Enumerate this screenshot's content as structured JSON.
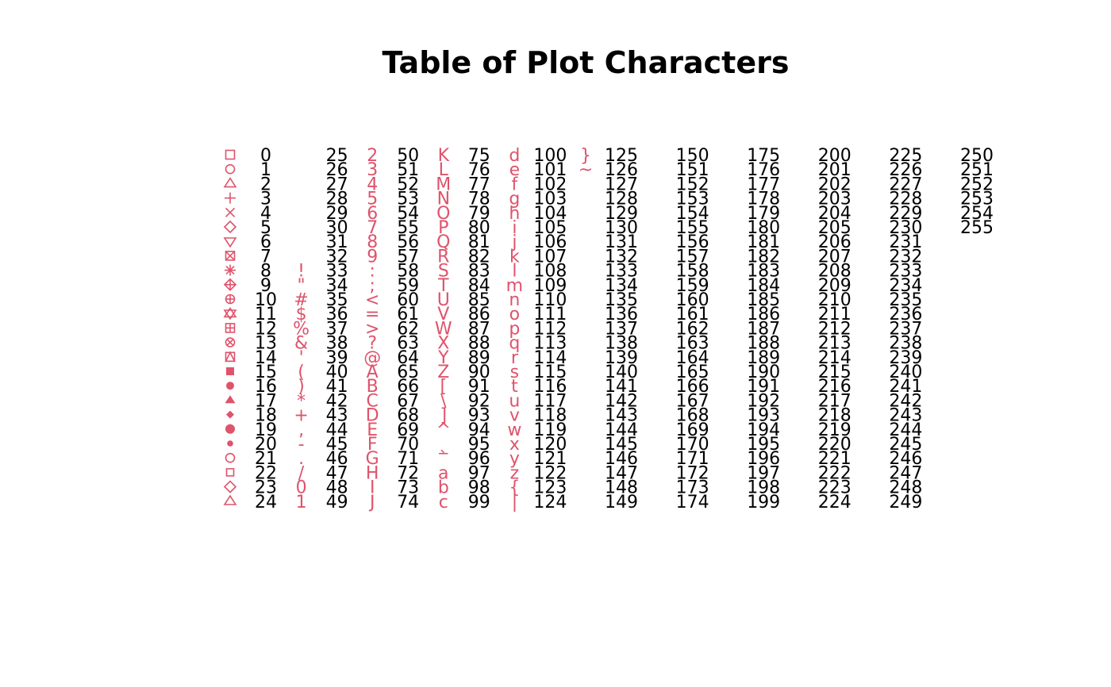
{
  "chart_data": {
    "type": "table",
    "title": "Table of Plot Characters",
    "symbol_color": "#DF536B",
    "number_color": "#000000",
    "codes": [
      0,
      1,
      2,
      3,
      4,
      5,
      6,
      7,
      8,
      9,
      10,
      11,
      12,
      13,
      14,
      15,
      16,
      17,
      18,
      19,
      20,
      21,
      22,
      23,
      24,
      25,
      26,
      27,
      28,
      29,
      30,
      31,
      32,
      33,
      34,
      35,
      36,
      37,
      38,
      39,
      40,
      41,
      42,
      43,
      44,
      45,
      46,
      47,
      48,
      49,
      50,
      51,
      52,
      53,
      54,
      55,
      56,
      57,
      58,
      59,
      60,
      61,
      62,
      63,
      64,
      65,
      66,
      67,
      68,
      69,
      70,
      71,
      72,
      73,
      74,
      75,
      76,
      77,
      78,
      79,
      80,
      81,
      82,
      83,
      84,
      85,
      86,
      87,
      88,
      89,
      90,
      91,
      92,
      93,
      94,
      95,
      96,
      97,
      98,
      99,
      100,
      101,
      102,
      103,
      104,
      105,
      106,
      107,
      108,
      109,
      110,
      111,
      112,
      113,
      114,
      115,
      116,
      117,
      118,
      119,
      120,
      121,
      122,
      123,
      124,
      125,
      126,
      127,
      128,
      129,
      130,
      131,
      132,
      133,
      134,
      135,
      136,
      137,
      138,
      139,
      140,
      141,
      142,
      143,
      144,
      145,
      146,
      147,
      148,
      149,
      150,
      151,
      152,
      153,
      154,
      155,
      156,
      157,
      158,
      159,
      160,
      161,
      162,
      163,
      164,
      165,
      166,
      167,
      168,
      169,
      170,
      171,
      172,
      173,
      174,
      175,
      176,
      177,
      178,
      179,
      180,
      181,
      182,
      183,
      184,
      185,
      186,
      187,
      188,
      189,
      190,
      191,
      192,
      193,
      194,
      195,
      196,
      197,
      198,
      199,
      200,
      201,
      202,
      203,
      204,
      205,
      206,
      207,
      208,
      209,
      210,
      211,
      212,
      213,
      214,
      215,
      216,
      217,
      218,
      219,
      220,
      221,
      222,
      223,
      224,
      225,
      226,
      227,
      228,
      229,
      230,
      231,
      232,
      233,
      234,
      235,
      236,
      237,
      238,
      239,
      240,
      241,
      242,
      243,
      244,
      245,
      246,
      247,
      248,
      249,
      250,
      251,
      252,
      253,
      254,
      255
    ],
    "pch_shapes": [
      "open-square",
      "open-circle",
      "open-triangle-up",
      "plus",
      "cross",
      "open-diamond",
      "open-triangle-down",
      "square-cross",
      "asterisk",
      "diamond-plus",
      "circle-plus",
      "star-of-david",
      "square-plus",
      "circle-cross",
      "square-triangle",
      "filled-square",
      "filled-circle",
      "filled-triangle",
      "filled-diamond",
      "large-filled-circle",
      "small-filled-circle",
      "bordered-circle",
      "bordered-square",
      "bordered-diamond",
      "bordered-triangle"
    ],
    "ascii_glyphs": {
      "32": "",
      "33": "!",
      "34": "\"",
      "35": "#",
      "36": "$",
      "37": "%",
      "38": "&",
      "39": "'",
      "40": "(",
      "41": ")",
      "42": "*",
      "43": "+",
      "44": ",",
      "45": "-",
      "46": ".",
      "47": "/",
      "48": "0",
      "49": "1",
      "50": "2",
      "51": "3",
      "52": "4",
      "53": "5",
      "54": "6",
      "55": "7",
      "56": "8",
      "57": "9",
      "58": ":",
      "59": ";",
      "60": "<",
      "61": "=",
      "62": ">",
      "63": "?",
      "64": "@",
      "65": "A",
      "66": "B",
      "67": "C",
      "68": "D",
      "69": "E",
      "70": "F",
      "71": "G",
      "72": "H",
      "73": "I",
      "74": "J",
      "75": "K",
      "76": "L",
      "77": "M",
      "78": "N",
      "79": "O",
      "80": "P",
      "81": "Q",
      "82": "R",
      "83": "S",
      "84": "T",
      "85": "U",
      "86": "V",
      "87": "W",
      "88": "X",
      "89": "Y",
      "90": "Z",
      "91": "[",
      "92": "\\",
      "93": "]",
      "94": "^",
      "95": "_",
      "96": "`",
      "97": "a",
      "98": "b",
      "99": "c",
      "100": "d",
      "101": "e",
      "102": "f",
      "103": "g",
      "104": "h",
      "105": "i",
      "106": "j",
      "107": "k",
      "108": "l",
      "109": "m",
      "110": "n",
      "111": "o",
      "112": "p",
      "113": "q",
      "114": "r",
      "115": "s",
      "116": "t",
      "117": "u",
      "118": "v",
      "119": "w",
      "120": "x",
      "121": "y",
      "122": "z",
      "123": "{",
      "124": "|",
      "125": "}",
      "126": "~"
    }
  }
}
